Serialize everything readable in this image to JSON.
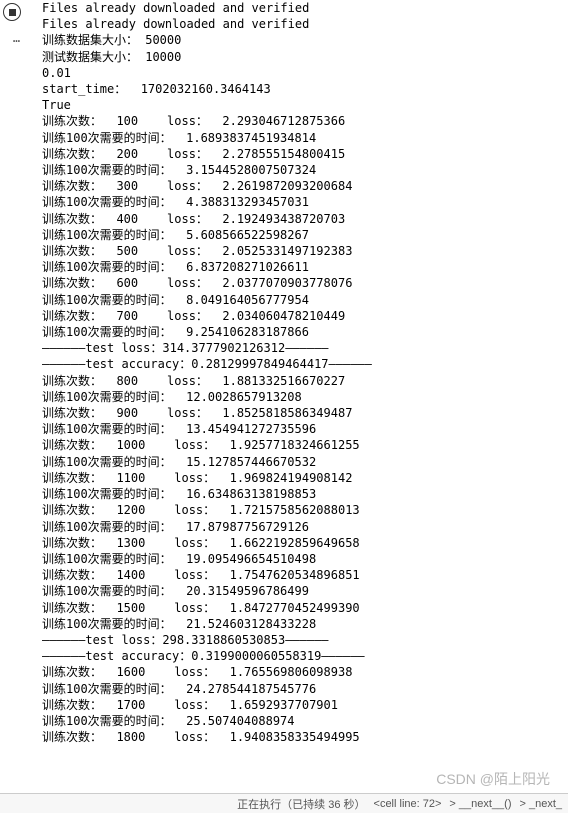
{
  "gutter": {
    "stop_icon": "stop",
    "more_icon": "…"
  },
  "lines": [
    "Files already downloaded and verified",
    "Files already downloaded and verified",
    "训练数据集大小： 50000",
    "测试数据集大小： 10000",
    "0.01",
    "start_time：  1702032160.3464143",
    "True",
    "训练次数：  100    loss：  2.293046712875366",
    "训练100次需要的时间：  1.6893837451934814",
    "训练次数：  200    loss：  2.278555154800415",
    "训练100次需要的时间：  3.1544528007507324",
    "训练次数：  300    loss：  2.2619872093200684",
    "训练100次需要的时间：  4.388313293457031",
    "训练次数：  400    loss：  2.192493438720703",
    "训练100次需要的时间：  5.608566522598267",
    "训练次数：  500    loss：  2.0525331497192383",
    "训练100次需要的时间：  6.837208271026611",
    "训练次数：  600    loss：  2.0377070903778076",
    "训练100次需要的时间：  8.049164056777954",
    "训练次数：  700    loss：  2.034060478210449",
    "训练100次需要的时间：  9.254106283187866",
    "——————test loss：314.3777902126312——————",
    "——————test accuracy：0.28129997849464417——————",
    "训练次数：  800    loss：  1.881332516670227",
    "训练100次需要的时间：  12.0028657913208",
    "训练次数：  900    loss：  1.8525818586349487",
    "训练100次需要的时间：  13.454941272735596",
    "训练次数：  1000    loss：  1.9257718324661255",
    "训练100次需要的时间：  15.127857446670532",
    "训练次数：  1100    loss：  1.969824194908142",
    "训练100次需要的时间：  16.634863138198853",
    "训练次数：  1200    loss：  1.7215758562088013",
    "训练100次需要的时间：  17.87987756729126",
    "训练次数：  1300    loss：  1.6622192859649658",
    "训练100次需要的时间：  19.095496654510498",
    "训练次数：  1400    loss：  1.7547620534896851",
    "训练100次需要的时间：  20.31549596786499",
    "训练次数：  1500    loss：  1.8472770452499390",
    "训练100次需要的时间：  21.524603128433228",
    "——————test loss：298.3318860530853——————",
    "——————test accuracy：0.3199000060558319——————",
    "训练次数：  1600    loss：  1.765569806098938",
    "训练100次需要的时间：  24.278544187545776",
    "训练次数：  1700    loss：  1.6592937707901",
    "训练100次需要的时间：  25.507404088974",
    "训练次数：  1800    loss：  1.9408358335494995"
  ],
  "watermark": "CSDN @陌上阳光",
  "status": {
    "running": "正在执行（已持续 36 秒）",
    "cell": "<cell line: 72>",
    "next1": "__next__()",
    "next2": "_next_"
  }
}
